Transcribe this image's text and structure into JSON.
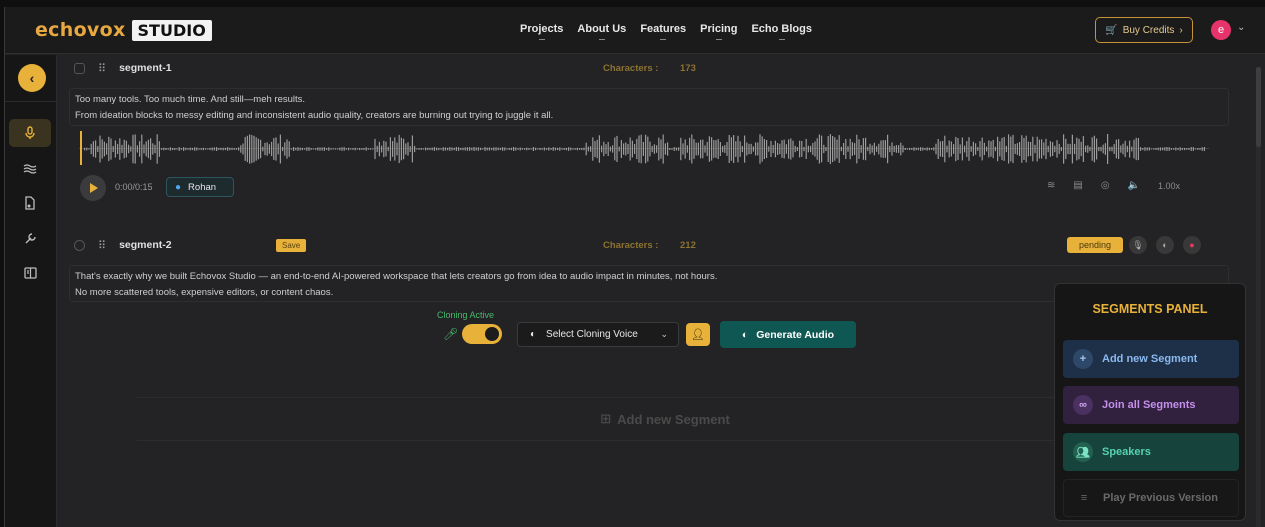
{
  "brand": {
    "word": "echovox",
    "badge": "STUDIO"
  },
  "nav": [
    "Projects",
    "About Us",
    "Features",
    "Pricing",
    "Echo Blogs"
  ],
  "header": {
    "buy_credits": "Buy Credits",
    "avatar_letter": "e"
  },
  "segments": [
    {
      "name": "segment-1",
      "characters_label": "Characters :",
      "characters": "173",
      "lines": [
        "Too many tools. Too much time. And still—meh results.",
        "From ideation blocks to messy editing and inconsistent audio quality, creators are burning out trying to juggle it all."
      ],
      "time": "0:00/0:15",
      "voice": "Rohan",
      "speed": "1.00x"
    },
    {
      "name": "segment-2",
      "save": "Save",
      "characters_label": "Characters :",
      "characters": "212",
      "status": "pending",
      "lines": [
        "That's exactly why we built Echovox Studio — an end-to-end AI-powered workspace that lets creators go from idea to audio impact in minutes, not hours.",
        "No more scattered tools, expensive editors, or content chaos."
      ]
    }
  ],
  "cloning": {
    "label": "Cloning Active",
    "select_voice": "Select Cloning Voice",
    "generate": "Generate Audio"
  },
  "add_segment_bottom": "Add new Segment",
  "panel": {
    "title": "SEGMENTS PANEL",
    "items": [
      "Add new Segment",
      "Join all Segments",
      "Speakers",
      "Play Previous Version"
    ]
  },
  "colors": {
    "accent": "#e8b23a",
    "teal": "#0f5752"
  }
}
